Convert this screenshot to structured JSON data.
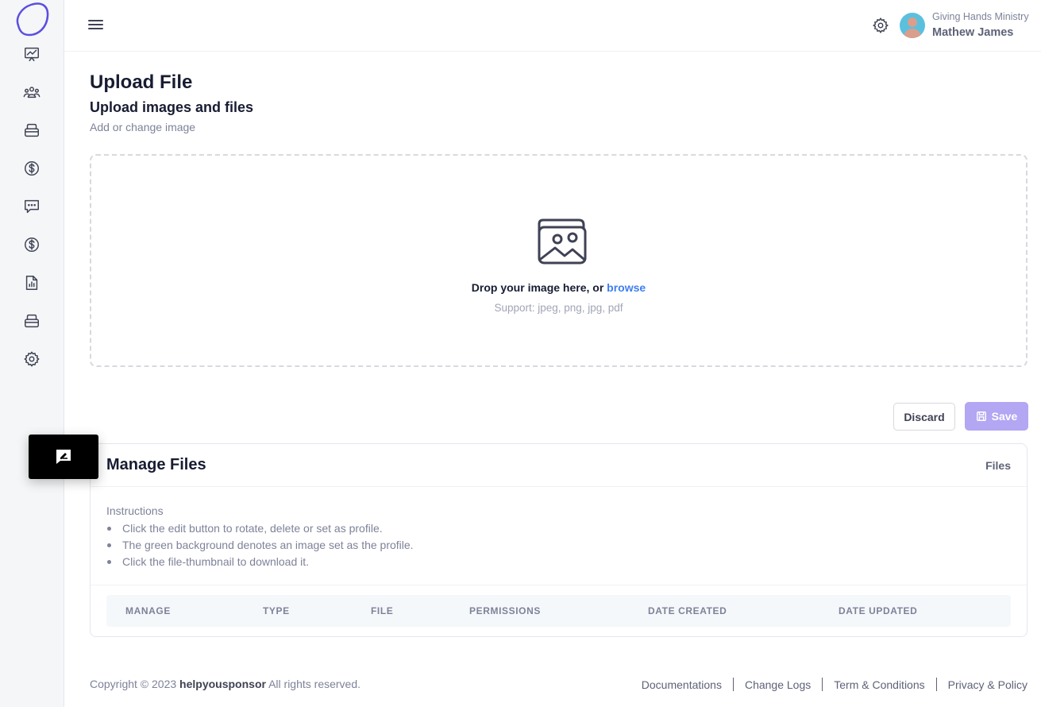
{
  "header": {
    "organization": "Giving Hands Ministry",
    "user_name": "Mathew James"
  },
  "sidebar": {
    "items": [
      {
        "icon": "chart-line-icon"
      },
      {
        "icon": "users-group-icon"
      },
      {
        "icon": "box-icon"
      },
      {
        "icon": "dollar-circle-icon"
      },
      {
        "icon": "message-dots-icon"
      },
      {
        "icon": "dollar-circle-icon"
      },
      {
        "icon": "report-file-icon"
      },
      {
        "icon": "box-icon"
      },
      {
        "icon": "gear-icon"
      }
    ]
  },
  "page": {
    "title": "Upload File",
    "subtitle": "Upload images and files",
    "hint": "Add or change image"
  },
  "dropzone": {
    "text": "Drop your image here, or",
    "browse": "browse",
    "support": "Support: jpeg, png, jpg, pdf"
  },
  "actions": {
    "discard": "Discard",
    "save": "Save"
  },
  "manage": {
    "title": "Manage Files",
    "tab": "Files",
    "instructions_title": "Instructions",
    "instructions": [
      "Click the edit button to rotate, delete or set as profile.",
      "The green background denotes an image set as the profile.",
      "Click the file-thumbnail to download it."
    ],
    "columns": [
      "MANAGE",
      "TYPE",
      "FILE",
      "PERMISSIONS",
      "DATE CREATED",
      "DATE UPDATED"
    ]
  },
  "footer": {
    "copyright_prefix": "Copyright © 2023",
    "brand": "helpyousponsor",
    "copyright_suffix": "All rights reserved.",
    "links": [
      "Documentations",
      "Change Logs",
      "Term & Conditions",
      "Privacy & Policy"
    ]
  },
  "colors": {
    "accent": "#3e7ff0",
    "save_button": "#b3a6f3",
    "logo": "#5b4ee0",
    "avatar": "#5bc0de"
  }
}
